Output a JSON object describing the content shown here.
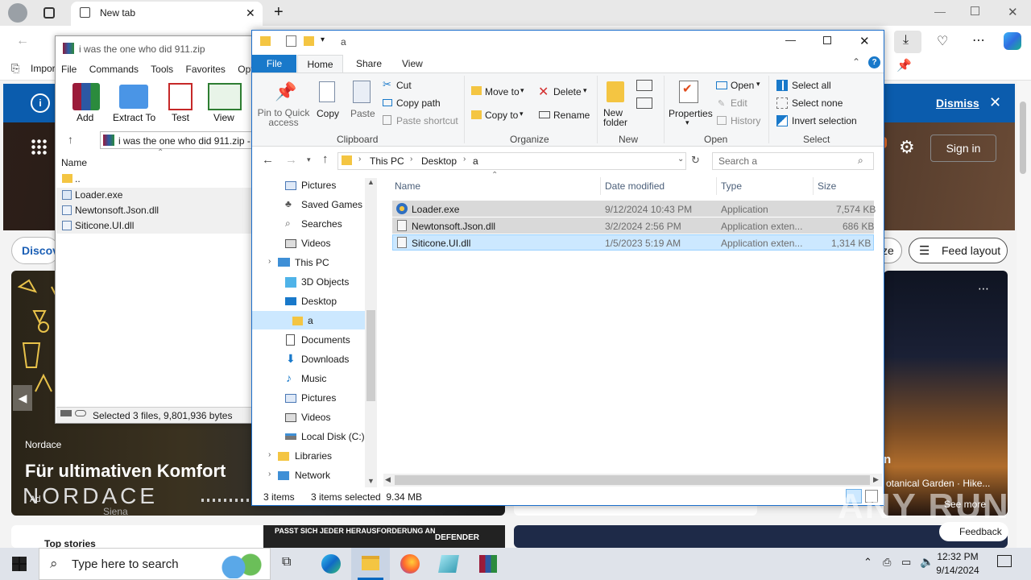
{
  "browser": {
    "tab_title": "New tab",
    "favorites_item": "Impor",
    "banner_dismiss": "Dismiss",
    "sign_in": "Sign in",
    "discover_label": "Discov",
    "pill_partial": "ze",
    "feed_layout": "Feed layout",
    "card1_brand": "Nordace",
    "card1_title": "Für ultimativen Komfort",
    "card1_logo": "NORDACE",
    "card1_ad": "Ad",
    "card1_sub": "Siena",
    "card3_text": "otanical Garden · Hike...",
    "card3_more": "See more",
    "bottom_ad_text": "PASST SICH JEDER HERAUSFORDERUNG AN",
    "bottom_ad_brand": "DEFENDER",
    "top_stories": "Top stories",
    "feedback": "Feedback",
    "n_partial": "n"
  },
  "winrar": {
    "title": "i was the one who did 911.zip",
    "menu": [
      "File",
      "Commands",
      "Tools",
      "Favorites",
      "Optio"
    ],
    "toolbar": [
      "Add",
      "Extract To",
      "Test",
      "View"
    ],
    "address": "i was the one who did 911.zip -",
    "col_name": "Name",
    "rows": [
      "..",
      "Loader.exe",
      "Newtonsoft.Json.dll",
      "Siticone.UI.dll"
    ],
    "status": "Selected 3 files, 9,801,936 bytes"
  },
  "explorer": {
    "title": "a",
    "tabs": [
      "File",
      "Home",
      "Share",
      "View"
    ],
    "ribbon": {
      "pin": "Pin to Quick access",
      "copy": "Copy",
      "paste": "Paste",
      "cut": "Cut",
      "copy_path": "Copy path",
      "paste_shortcut": "Paste shortcut",
      "clipboard": "Clipboard",
      "move_to": "Move to",
      "copy_to": "Copy to",
      "delete": "Delete",
      "rename": "Rename",
      "organize": "Organize",
      "new_folder": "New folder",
      "new": "New",
      "properties": "Properties",
      "open": "Open",
      "edit": "Edit",
      "history": "History",
      "open_group": "Open",
      "select_all": "Select all",
      "select_none": "Select none",
      "invert_selection": "Invert selection",
      "select_group": "Select"
    },
    "breadcrumb": [
      "This PC",
      "Desktop",
      "a"
    ],
    "search_placeholder": "Search a",
    "nav": [
      "Pictures",
      "Saved Games",
      "Searches",
      "Videos",
      "This PC",
      "3D Objects",
      "Desktop",
      "a",
      "Documents",
      "Downloads",
      "Music",
      "Pictures",
      "Videos",
      "Local Disk (C:)",
      "Libraries",
      "Network"
    ],
    "columns": [
      "Name",
      "Date modified",
      "Type",
      "Size"
    ],
    "files": [
      {
        "name": "Loader.exe",
        "date": "9/12/2024 10:43 PM",
        "type": "Application",
        "size": "7,574 KB"
      },
      {
        "name": "Newtonsoft.Json.dll",
        "date": "3/2/2024 2:56 PM",
        "type": "Application exten...",
        "size": "686 KB"
      },
      {
        "name": "Siticone.UI.dll",
        "date": "1/5/2023 5:19 AM",
        "type": "Application exten...",
        "size": "1,314 KB"
      }
    ],
    "status_items": "3 items",
    "status_selected": "3 items selected  9.34 MB"
  },
  "taskbar": {
    "search_placeholder": "Type here to search",
    "time": "12:32 PM",
    "date": "9/14/2024"
  },
  "watermark": "ANY RUN"
}
